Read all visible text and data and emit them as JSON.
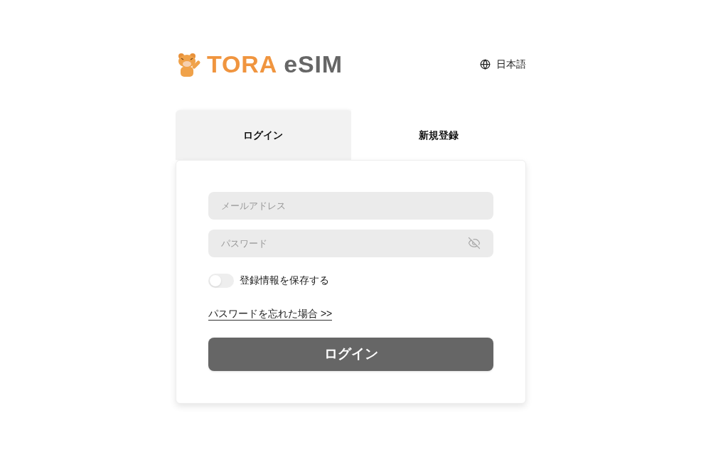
{
  "header": {
    "logo": {
      "brand": "TORA",
      "product": "eSIM"
    },
    "language": "日本語"
  },
  "tabs": [
    {
      "label": "ログイン",
      "selected": true
    },
    {
      "label": "新規登録",
      "selected": false
    }
  ],
  "form": {
    "email": {
      "placeholder": "メールアドレス"
    },
    "password": {
      "placeholder": "パスワード"
    },
    "remember": {
      "label": "登録情報を保存する",
      "on": false
    },
    "forgot_link": "パスワードを忘れた場合 >>",
    "submit": "ログイン"
  }
}
